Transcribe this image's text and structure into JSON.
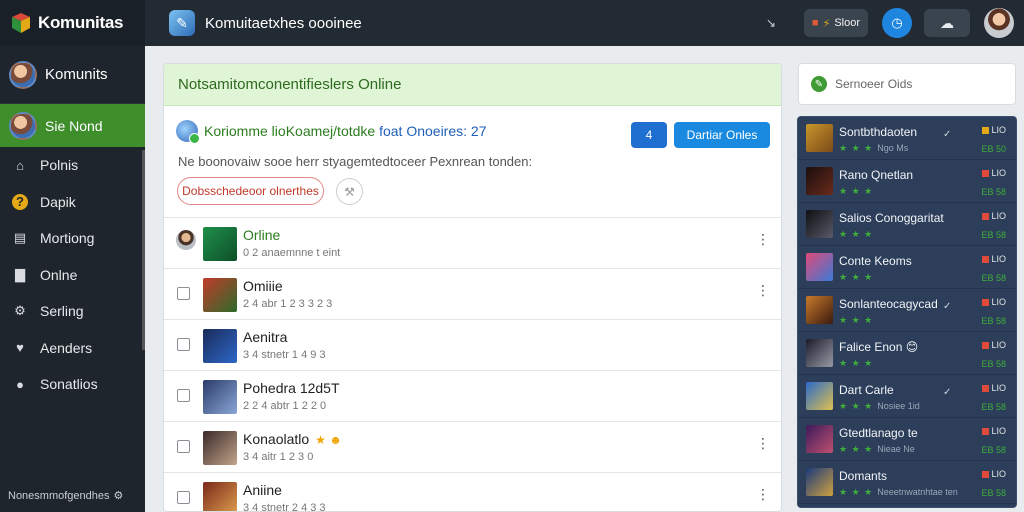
{
  "sidebar": {
    "brand": "Komunitas",
    "user_name": "Komunits",
    "active_label": "Sie Nond",
    "items": [
      {
        "label": "Polnis",
        "icon": "home-icon"
      },
      {
        "label": "Dapik",
        "icon": "question-icon"
      },
      {
        "label": "Mortiong",
        "icon": "folder-icon"
      },
      {
        "label": "Onlne",
        "icon": "chart-icon"
      },
      {
        "label": "Serling",
        "icon": "gear-icon"
      },
      {
        "label": "Aenders",
        "icon": "heart-icon"
      },
      {
        "label": "Sonatlios",
        "icon": "globe-icon"
      }
    ],
    "footer": "Nonesmmofgendhes"
  },
  "topbar": {
    "title": "Komuitaetxhes oooinee",
    "tiny": "↘",
    "pill_label": "Sloor",
    "pill_icon": "badge-icon"
  },
  "main": {
    "header": "Notsamitomconentifieslers Online",
    "info_title": "Koriomme lioKoamej/totdke",
    "info_title_blue": "foat Onoeires: 27",
    "small_button": "4",
    "primary_button": "Dartiar Onles",
    "description": "Ne boonovaiw sooe herr styagemtedtoceer Pexnrean tonden:",
    "outline_button": "Dobsschedeoor olnerthes",
    "rows": [
      {
        "title": "Orline",
        "sub": "0 2 anaemnne t eint",
        "green": true,
        "lead": "avatar",
        "kebab": true,
        "thumb": [
          "#1e8f4a",
          "#0f4f2a"
        ]
      },
      {
        "title": "Omiiie",
        "sub": "2 4 abr 1 2 3 3 2 3",
        "green": false,
        "lead": "check",
        "kebab": true,
        "thumb": [
          "#c23b2a",
          "#2c6b2a"
        ]
      },
      {
        "title": "Aenitra",
        "sub": "3 4 stnetr 1 4 9 3",
        "green": false,
        "lead": "check",
        "kebab": false,
        "thumb": [
          "#1a2b5a",
          "#2e67c9"
        ]
      },
      {
        "title": "Pohedra 12d5T",
        "sub": "2 2 4 abtr 1 2 2 0",
        "green": false,
        "lead": "check",
        "kebab": false,
        "thumb": [
          "#2a3b6a",
          "#8aa7d6"
        ]
      },
      {
        "title": "Konaolatlo",
        "sub": "3 4 aitr 1 2 3 0",
        "green": false,
        "lead": "check",
        "kebab": true,
        "thumb": [
          "#3a2a2a",
          "#c2a48a"
        ],
        "emoji": "★ ☻"
      },
      {
        "title": "Aniine",
        "sub": "3 4 stnetr 2 4 3 3",
        "green": false,
        "lead": "check",
        "kebab": true,
        "thumb": [
          "#7a2a1a",
          "#e0a050"
        ]
      }
    ]
  },
  "search": {
    "text": "Sernoeer Oids"
  },
  "rpanel": {
    "items": [
      {
        "title": "Sontbthdaoten",
        "stars": "★ ★ ★",
        "sub": "Ngo Ms",
        "badge": "LIO",
        "badge_color": "gold",
        "small": "EB 50",
        "check": "✓",
        "thumb": [
          "#c9962a",
          "#7a4a1a"
        ]
      },
      {
        "title": "Rano Qnetlan",
        "stars": "★ ★ ★",
        "sub": "",
        "badge": "LIO",
        "badge_color": "red",
        "small": "EB 58",
        "check": "",
        "thumb": [
          "#1a0e0e",
          "#6a2a1a"
        ]
      },
      {
        "title": "Salios Conoggaritat",
        "stars": "★ ★ ★",
        "sub": "",
        "badge": "LIO",
        "badge_color": "red",
        "small": "EB 58",
        "check": "",
        "thumb": [
          "#0e0e12",
          "#5a5a6a"
        ]
      },
      {
        "title": "Conte Keoms",
        "stars": "★ ★ ★",
        "sub": "",
        "badge": "LIO",
        "badge_color": "red",
        "small": "EB 58",
        "check": "",
        "thumb": [
          "#e04a7a",
          "#3a7ad6"
        ]
      },
      {
        "title": "Sonlanteocagycad",
        "stars": "★ ★ ★",
        "sub": "",
        "badge": "LIO",
        "badge_color": "red",
        "small": "EB 58",
        "check": "✓",
        "thumb": [
          "#c97a2a",
          "#3a1a0e"
        ]
      },
      {
        "title": "Falice Enon 😊",
        "stars": "★ ★ ★",
        "sub": "",
        "badge": "LIO",
        "badge_color": "red",
        "small": "EB 58",
        "check": "",
        "thumb": [
          "#1a1a2a",
          "#9a9aa6"
        ]
      },
      {
        "title": "Dart Carle",
        "stars": "★ ★ ★",
        "sub": "Nosiee 1id",
        "badge": "LIO",
        "badge_color": "red",
        "small": "EB 58",
        "check": "✓",
        "thumb": [
          "#2a6ac9",
          "#e0c050"
        ]
      },
      {
        "title": "Gtedtlanago te",
        "stars": "★ ★ ★",
        "sub": "Nieae Ne",
        "badge": "LIO",
        "badge_color": "red",
        "small": "EB 58",
        "check": "",
        "thumb": [
          "#3a1a5a",
          "#c05070"
        ]
      },
      {
        "title": "Domants",
        "stars": "★ ★ ★",
        "sub": "Neeetnwatnhtae ten",
        "badge": "LIO",
        "badge_color": "red",
        "small": "EB 58",
        "check": "",
        "thumb": [
          "#1a3a7a",
          "#d0a040"
        ]
      }
    ]
  }
}
